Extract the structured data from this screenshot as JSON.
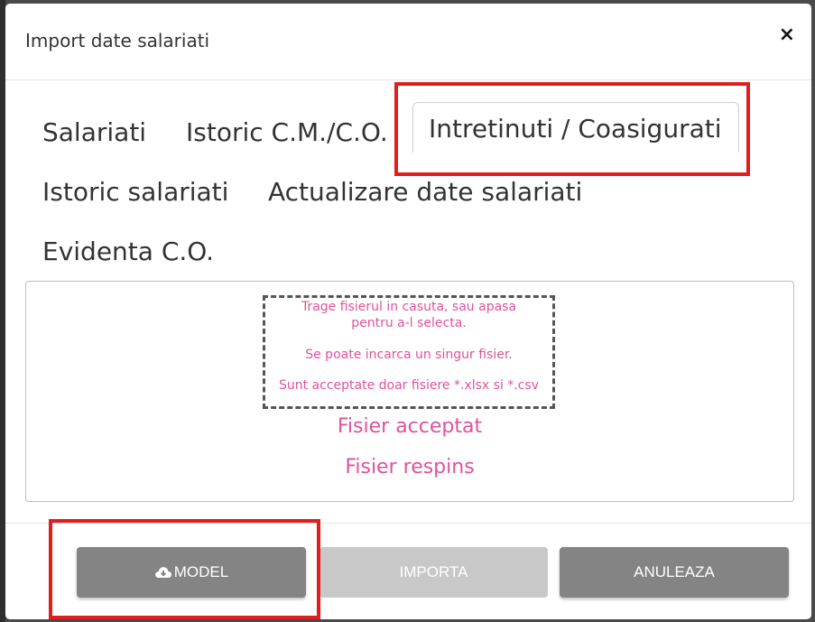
{
  "dialog": {
    "title": "Import date salariati",
    "close_icon": "×"
  },
  "tabs": [
    {
      "label": "Salariati",
      "active": false
    },
    {
      "label": "Istoric C.M./C.O.",
      "active": false
    },
    {
      "label": "Intretinuti / Coasigurati",
      "active": true
    },
    {
      "label": "Istoric salariati",
      "active": false
    },
    {
      "label": "Actualizare date salariati",
      "active": false
    },
    {
      "label": "Evidenta C.O.",
      "active": false
    }
  ],
  "dropzone": {
    "line1": "Trage fisierul in casuta, sau apasa",
    "line2": "pentru a-l selecta.",
    "line3": "Se poate incarca un singur fisier.",
    "line4": "Sunt acceptate doar fisiere *.xlsx si *.csv",
    "accepted": "Fisier acceptat",
    "rejected": "Fisier respins"
  },
  "buttons": {
    "model": "MODEL",
    "model_icon": "cloud-download-icon",
    "import": "IMPORTA",
    "cancel": "ANULEAZA"
  },
  "colors": {
    "accent_pink": "#e0529c",
    "button_gray": "#848484",
    "button_disabled": "#c8c8c8",
    "highlight_red": "#e01e1e"
  }
}
